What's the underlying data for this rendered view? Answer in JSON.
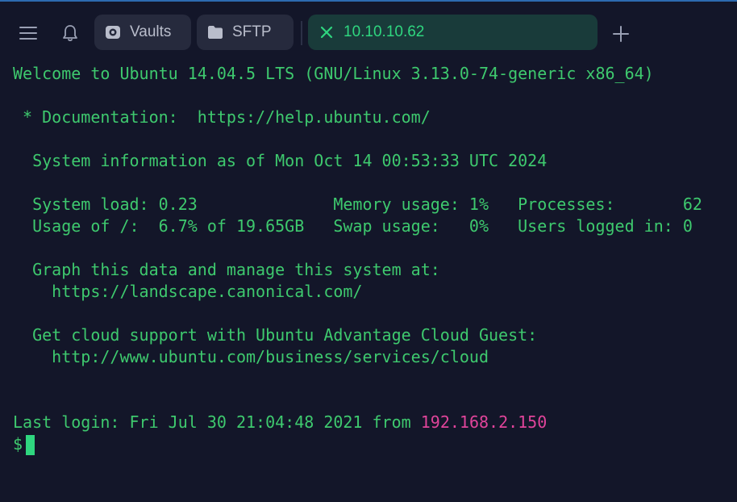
{
  "tabs": {
    "vaults_label": "Vaults",
    "sftp_label": "SFTP",
    "active_label": "10.10.10.62"
  },
  "icons": {
    "menu": "hamburger-menu-icon",
    "bell": "bell-icon",
    "vaults": "vaults-icon",
    "sftp": "folder-icon",
    "close": "close-icon",
    "add": "plus-icon"
  },
  "colors": {
    "background": "#131629",
    "terminal_text": "#3ec96e",
    "ip_highlight": "#e0449a",
    "active_tab_bg": "#193b3a",
    "tab_bg": "#262a3d"
  },
  "terminal": {
    "welcome": "Welcome to Ubuntu 14.04.5 LTS (GNU/Linux 3.13.0-74-generic x86_64)",
    "documentation": " * Documentation:  https://help.ubuntu.com/",
    "sysinfo": "  System information as of Mon Oct 14 00:53:33 UTC 2024",
    "stats_1": "  System load: 0.23              Memory usage: 1%   Processes:       62",
    "stats_2": "  Usage of /:  6.7% of 19.65GB   Swap usage:   0%   Users logged in: 0",
    "graph_1": "  Graph this data and manage this system at:",
    "graph_2": "    https://landscape.canonical.com/",
    "cloud_1": "  Get cloud support with Ubuntu Advantage Cloud Guest:",
    "cloud_2": "    http://www.ubuntu.com/business/services/cloud",
    "last_login_prefix": "Last login: Fri Jul 30 21:04:48 2021 from ",
    "last_login_ip": "192.168.2.150",
    "prompt": "$"
  }
}
